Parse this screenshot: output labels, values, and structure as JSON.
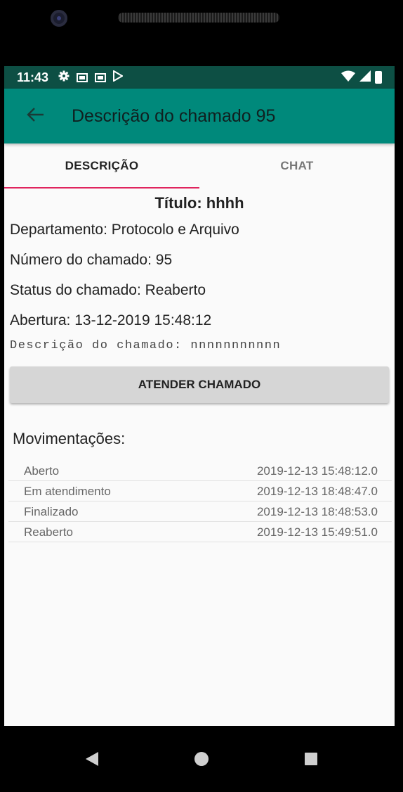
{
  "status_bar": {
    "time": "11:43",
    "icons": [
      "gear-icon",
      "gmail-icon",
      "gmail-icon",
      "play-store-icon"
    ],
    "right_icons": [
      "wifi-icon",
      "signal-icon",
      "battery-icon"
    ]
  },
  "app_bar": {
    "title": "Descrição do chamado 95",
    "color": "#00897b",
    "back_icon": "arrow-left-icon"
  },
  "tabs": [
    {
      "label": "DESCRIÇÃO",
      "active": true
    },
    {
      "label": "CHAT",
      "active": false
    }
  ],
  "tab_indicator_color": "#e0245e",
  "details": {
    "title": "Título: hhhh",
    "department": "Departamento: Protocolo e Arquivo",
    "number": "Número do chamado: 95",
    "status": "Status do chamado: Reaberto",
    "opened": "Abertura: 13-12-2019 15:48:12",
    "description": "Descrição do chamado: nnnnnnnnnnn"
  },
  "action_button": {
    "label": "ATENDER CHAMADO"
  },
  "movements": {
    "title": "Movimentações:",
    "rows": [
      {
        "status": "Aberto",
        "timestamp": "2019-12-13 15:48:12.0"
      },
      {
        "status": "Em atendimento",
        "timestamp": "2019-12-13 18:48:47.0"
      },
      {
        "status": "Finalizado",
        "timestamp": "2019-12-13 18:48:53.0"
      },
      {
        "status": "Reaberto",
        "timestamp": "2019-12-13 15:49:51.0"
      }
    ]
  },
  "nav_bar": {
    "icons": [
      "nav-back-icon",
      "nav-home-icon",
      "nav-recents-icon"
    ]
  }
}
